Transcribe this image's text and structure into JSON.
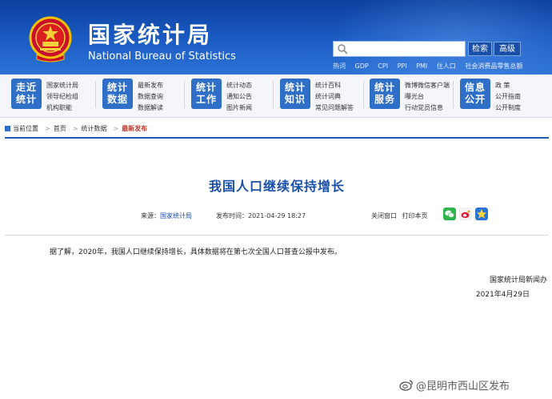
{
  "header": {
    "title_cn": "国家统计局",
    "title_en": "National Bureau of Statistics",
    "search_button": "检索",
    "advanced_button": "高级",
    "hot_links": [
      "热词",
      "GDP",
      "CPI",
      "PPI",
      "PMI",
      "住人口",
      "社会消费品零售总额"
    ]
  },
  "nav": {
    "groups": [
      {
        "badge": [
          "走近",
          "统计"
        ],
        "links": [
          "国家统计局",
          "领导纪检组",
          "机构职能"
        ]
      },
      {
        "badge": [
          "统计",
          "数据"
        ],
        "links": [
          "最新发布",
          "数据查询",
          "数据解读"
        ]
      },
      {
        "badge": [
          "统计",
          "工作"
        ],
        "links": [
          "统计动态",
          "通知公告",
          "图片新闻"
        ]
      },
      {
        "badge": [
          "统计",
          "知识"
        ],
        "links": [
          "统计百科",
          "统计词典",
          "常见问题解答"
        ]
      },
      {
        "badge": [
          "统计",
          "服务"
        ],
        "links": [
          "微博微信客户端",
          "曝光台",
          "行动党员信息"
        ]
      },
      {
        "badge": [
          "信息",
          "公开"
        ],
        "links": [
          "政  策",
          "公开指南",
          "公开制度"
        ]
      }
    ]
  },
  "breadcrumb": {
    "items": [
      "当前位置",
      "首页",
      "统计数据",
      "最新发布"
    ]
  },
  "article": {
    "title": "我国人口继续保持增长",
    "source_label": "来源：",
    "source": "国家统计局",
    "date_label": "发布时间：",
    "date": "2021-04-29  18:27",
    "close_window": "关闭窗口",
    "print": "打印本页",
    "body": "据了解，2020年，我国人口继续保持增长，具体数据将在第七次全国人口普查公报中发布。",
    "signature_org": "国家统计局新闻办",
    "signature_date": "2021年4月29日"
  },
  "watermark": "@昆明市西山区发布",
  "colors": {
    "header_blue": "#1b5cc4",
    "badge_blue": "#2f6fc7",
    "title_blue": "#1a4fa8",
    "current_red": "#c0392b"
  },
  "icons": {
    "share": [
      "wechat-icon",
      "weibo-icon",
      "qzone-icon"
    ]
  }
}
